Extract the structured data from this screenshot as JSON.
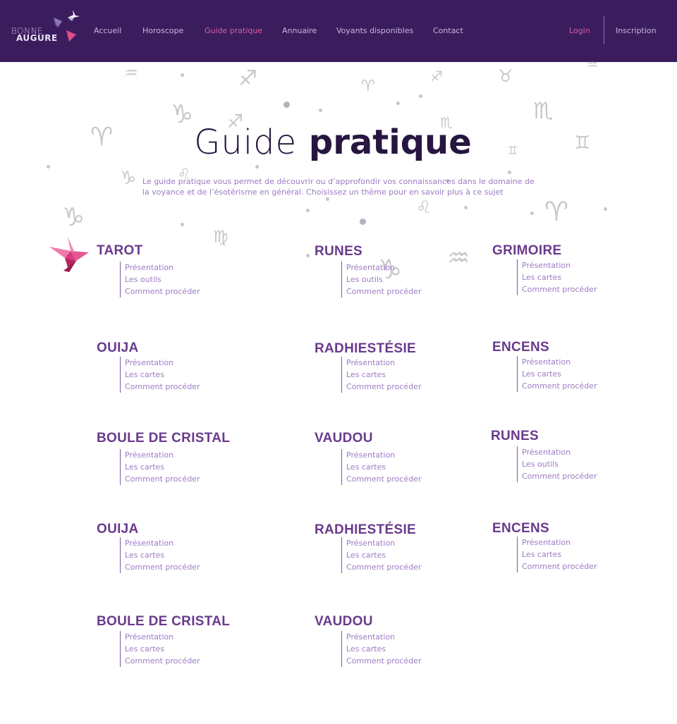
{
  "brand": {
    "line1": "BONNE",
    "line2": "AUGURE"
  },
  "nav": {
    "items": [
      {
        "label": "Accueil",
        "active": false
      },
      {
        "label": "Horoscope",
        "active": false
      },
      {
        "label": "Guide pratique",
        "active": true
      },
      {
        "label": "Annuaire",
        "active": false
      },
      {
        "label": "Voyants disponibles",
        "active": false
      },
      {
        "label": "Contact",
        "active": false
      }
    ],
    "login": "Login",
    "signup": "Inscription"
  },
  "hero": {
    "title_light": "Guide",
    "title_bold": "pratique",
    "subtitle": "Le guide pratique vous permet de découvrir ou d’approfondir vos connaissances dans le domaine de la voyance et de l’ésotérisme en général. Choisissez un thème pour en savoir plus à ce sujet"
  },
  "zodiac_icons": [
    "aquarius-icon",
    "sagittarius-icon",
    "aries-icon",
    "sagittarius-icon",
    "taurus-icon",
    "capricorn-icon",
    "sagittarius-icon",
    "scorpio-icon",
    "scorpio-icon",
    "aries-icon",
    "gemini-icon",
    "gemini-icon",
    "capricorn-icon",
    "leo-icon",
    "leo-icon",
    "capricorn-icon",
    "aries-icon",
    "virgo-icon",
    "capricorn-icon",
    "aquarius-icon",
    "aquarius-icon"
  ],
  "sections": [
    {
      "title": "TAROT",
      "links": [
        "Présentation",
        "Les outils",
        "Comment procéder"
      ]
    },
    {
      "title": "RUNES",
      "links": [
        "Présentation",
        "Les outils",
        "Comment procéder"
      ]
    },
    {
      "title": "GRIMOIRE",
      "links": [
        "Présentation",
        "Les cartes",
        "Comment procéder"
      ]
    },
    {
      "title": "OUIJA",
      "links": [
        "Présentation",
        "Les cartes",
        "Comment procéder"
      ]
    },
    {
      "title": "RADHIESTÉSIE",
      "links": [
        "Présentation",
        "Les cartes",
        "Comment procéder"
      ]
    },
    {
      "title": "ENCENS",
      "links": [
        "Présentation",
        "Les cartes",
        "Comment procéder"
      ]
    },
    {
      "title": "BOULE DE CRISTAL",
      "links": [
        "Présentation",
        "Les cartes",
        "Comment procéder"
      ]
    },
    {
      "title": "VAUDOU",
      "links": [
        "Présentation",
        "Les cartes",
        "Comment procéder"
      ]
    },
    {
      "title": "RUNES",
      "links": [
        "Présentation",
        "Les outils",
        "Comment procéder"
      ]
    },
    {
      "title": "OUIJA",
      "links": [
        "Présentation",
        "Les cartes",
        "Comment procéder"
      ]
    },
    {
      "title": "RADHIESTÉSIE",
      "links": [
        "Présentation",
        "Les cartes",
        "Comment procéder"
      ]
    },
    {
      "title": "ENCENS",
      "links": [
        "Présentation",
        "Les cartes",
        "Comment procéder"
      ]
    },
    {
      "title": "BOULE DE CRISTAL",
      "links": [
        "Présentation",
        "Les cartes",
        "Comment procéder"
      ]
    },
    {
      "title": "VAUDOU",
      "links": [
        "Présentation",
        "Les cartes",
        "Comment procéder"
      ]
    }
  ],
  "colors": {
    "navbar": "#3b1d5e",
    "accent": "#d45fa0",
    "section_title": "#6a3a8d",
    "link": "#9d7cc4",
    "hero_title": "#271640"
  }
}
